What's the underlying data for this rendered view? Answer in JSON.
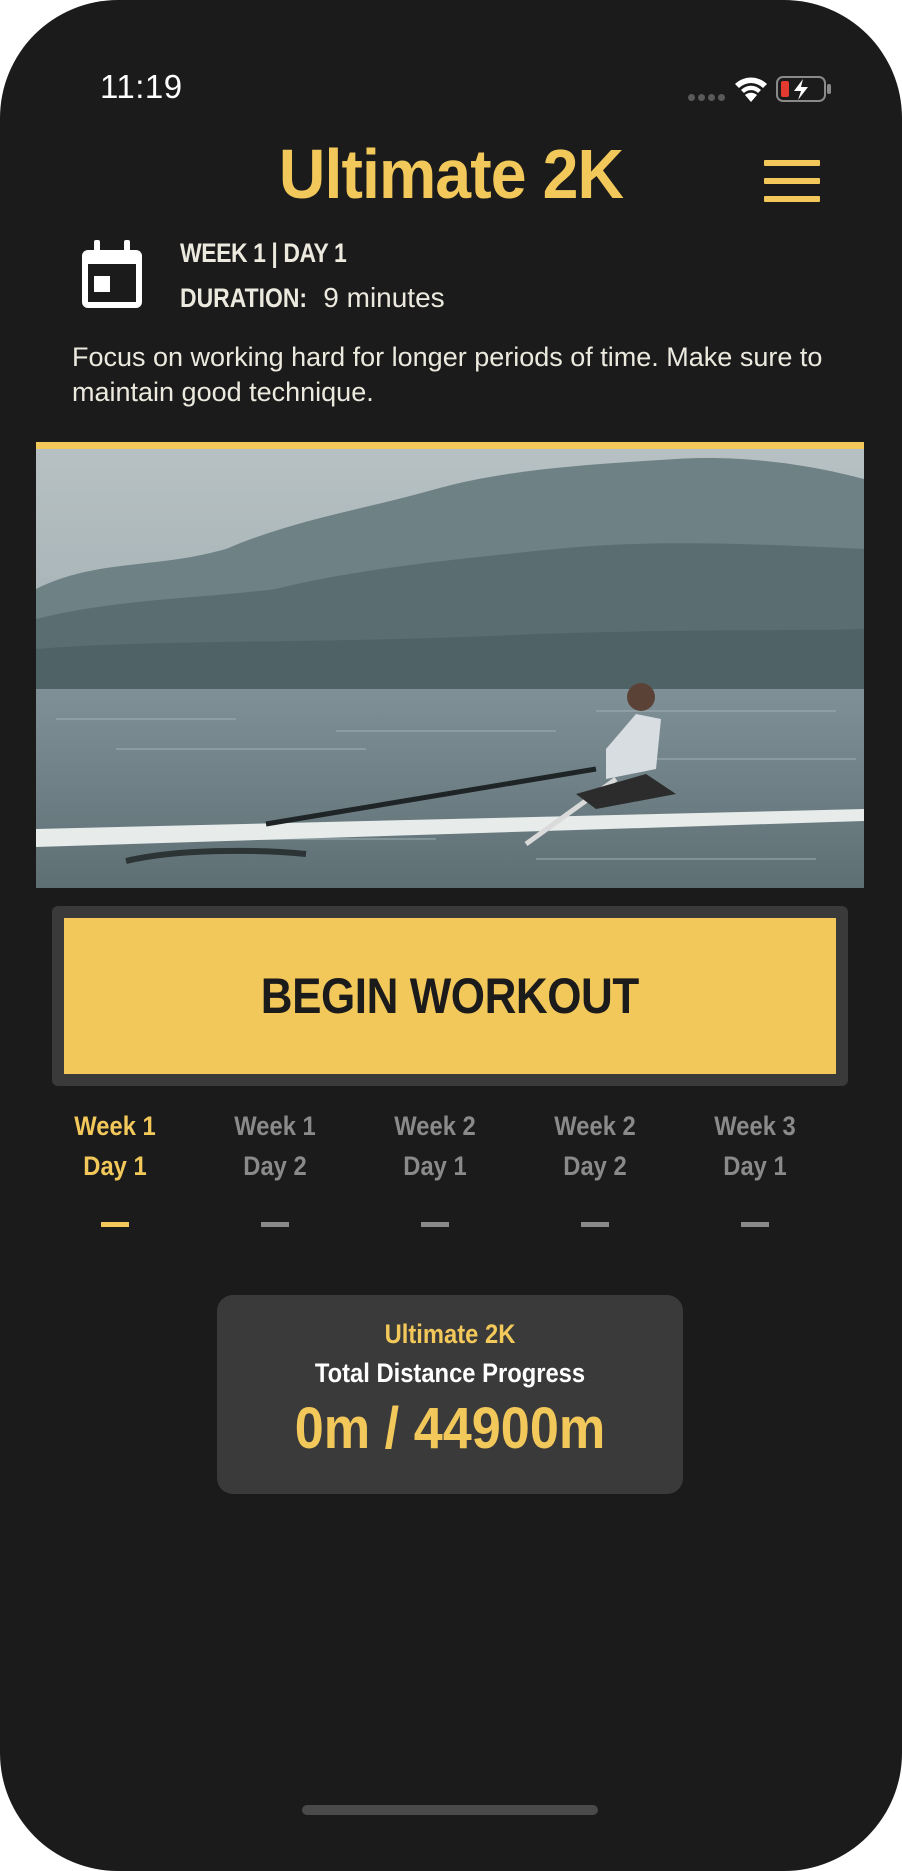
{
  "status_bar": {
    "time": "11:19",
    "icons": [
      "signal-icon",
      "wifi-icon",
      "battery-charging-icon"
    ]
  },
  "header": {
    "title": "Ultimate 2K",
    "menu_icon": "hamburger-menu-icon"
  },
  "workout": {
    "icon": "calendar-icon",
    "week_day": "WEEK 1 | DAY 1",
    "duration_label": "DURATION:",
    "duration_value": "9 minutes",
    "description": "Focus on working hard for longer periods of time. Make sure to maintain good technique."
  },
  "hero_image": {
    "alt": "rower-on-misty-lake"
  },
  "begin_button": {
    "label": "BEGIN WORKOUT"
  },
  "schedule": {
    "items": [
      {
        "week": "Week 1",
        "day": "Day 1",
        "active": true
      },
      {
        "week": "Week 1",
        "day": "Day 2",
        "active": false
      },
      {
        "week": "Week 2",
        "day": "Day 1",
        "active": false
      },
      {
        "week": "Week 2",
        "day": "Day 2",
        "active": false
      },
      {
        "week": "Week 3",
        "day": "Day 1",
        "active": false
      }
    ]
  },
  "progress": {
    "program": "Ultimate 2K",
    "label": "Total Distance Progress",
    "value": "0m / 44900m"
  },
  "colors": {
    "accent": "#f3c85a",
    "background": "#1b1b1b",
    "card": "#3a3a3a",
    "inactive": "#8a8a8a"
  }
}
